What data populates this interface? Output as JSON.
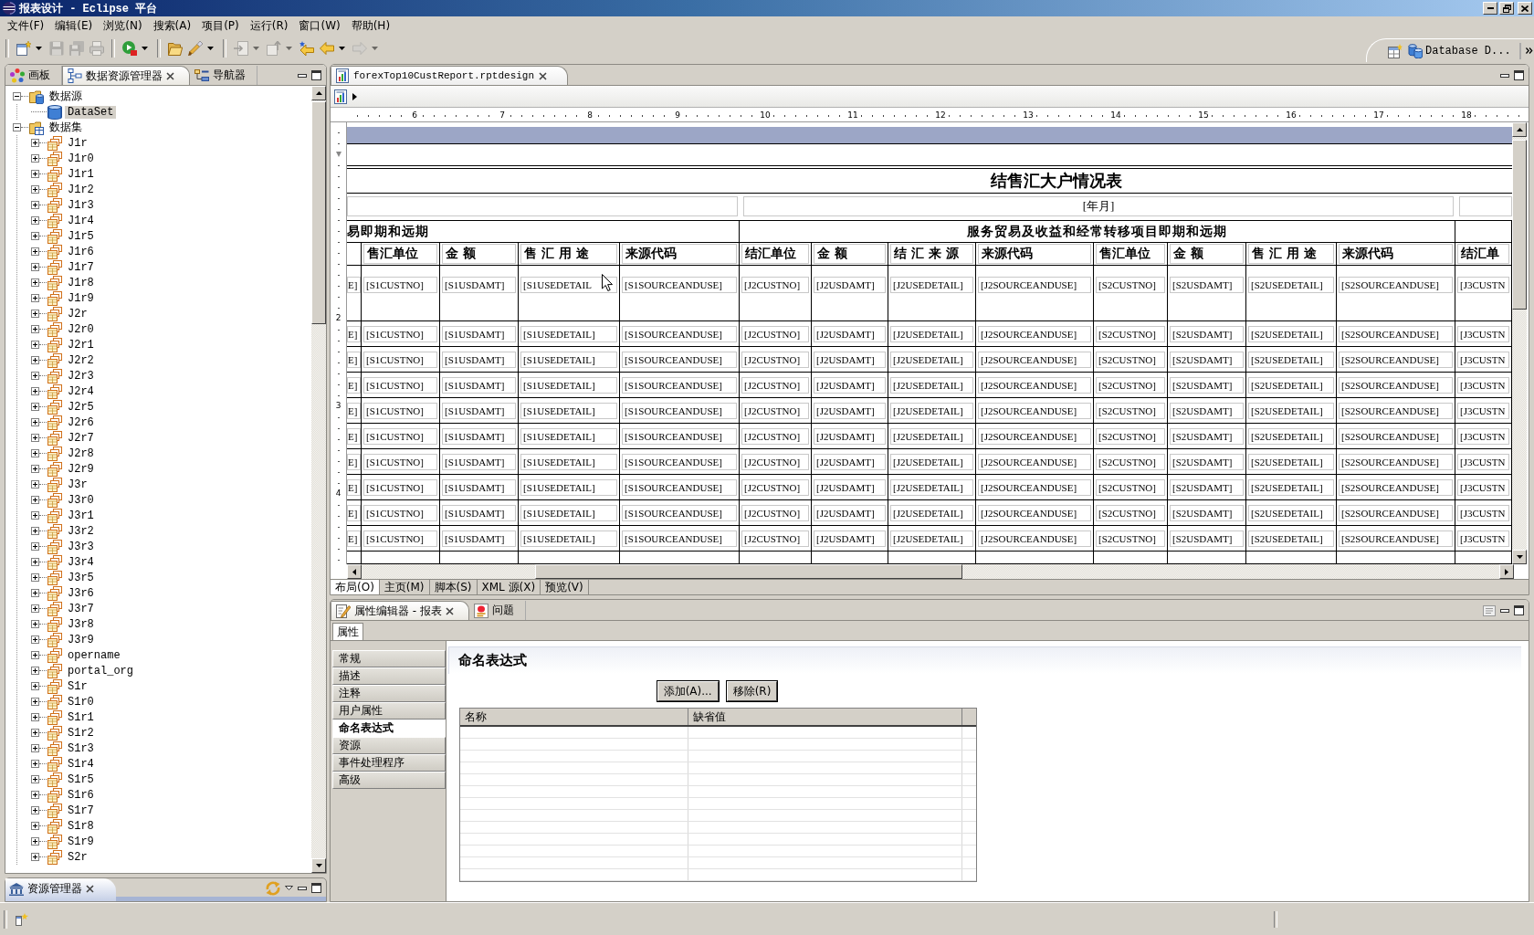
{
  "window": {
    "title": "报表设计 - Eclipse 平台"
  },
  "menu": [
    "文件(F)",
    "编辑(E)",
    "浏览(N)",
    "搜索(A)",
    "项目(P)",
    "运行(R)",
    "窗口(W)",
    "帮助(H)"
  ],
  "toolbar": [
    [
      {
        "kind": "new",
        "disabled": false,
        "dropdown": true
      },
      {
        "kind": "save",
        "disabled": true,
        "dropdown": false
      },
      {
        "kind": "saveall",
        "disabled": true,
        "dropdown": false
      },
      {
        "kind": "print",
        "disabled": true,
        "dropdown": false
      }
    ],
    [
      {
        "kind": "run",
        "disabled": false,
        "dropdown": true
      }
    ],
    [
      {
        "kind": "open",
        "disabled": false,
        "dropdown": false
      },
      {
        "kind": "brush",
        "disabled": false,
        "dropdown": true
      }
    ],
    [
      {
        "kind": "import",
        "disabled": true,
        "dropdown": true
      },
      {
        "kind": "export",
        "disabled": true,
        "dropdown": true
      },
      {
        "kind": "lastedit",
        "disabled": false,
        "dropdown": false
      },
      {
        "kind": "back",
        "disabled": false,
        "dropdown": true
      },
      {
        "kind": "forward",
        "disabled": true,
        "dropdown": true
      }
    ]
  ],
  "perspective_bar": {
    "label": "Database D..."
  },
  "left_panel": {
    "tabs": [
      {
        "label": "画板",
        "kind": "palette",
        "selected": false,
        "closable": false
      },
      {
        "label": "数据资源管理器",
        "kind": "data",
        "selected": true,
        "closable": true
      },
      {
        "label": "导航器",
        "kind": "navigator",
        "selected": false,
        "closable": false
      }
    ],
    "tree": [
      {
        "label": "数据源",
        "kind": "sources",
        "expanded": true,
        "selected": false,
        "children": [
          {
            "label": "DataSet",
            "selected": true
          }
        ]
      },
      {
        "label": "数据集",
        "kind": "sets",
        "expanded": true,
        "selected": false,
        "children": [
          {
            "label": "J1r",
            "expanded": false,
            "selected": false
          },
          {
            "label": "J1r0",
            "expanded": false,
            "selected": false
          },
          {
            "label": "J1r1",
            "expanded": false,
            "selected": false
          },
          {
            "label": "J1r2",
            "expanded": false,
            "selected": false
          },
          {
            "label": "J1r3",
            "expanded": false,
            "selected": false
          },
          {
            "label": "J1r4",
            "expanded": false,
            "selected": false
          },
          {
            "label": "J1r5",
            "expanded": false,
            "selected": false
          },
          {
            "label": "J1r6",
            "expanded": false,
            "selected": false
          },
          {
            "label": "J1r7",
            "expanded": false,
            "selected": false
          },
          {
            "label": "J1r8",
            "expanded": false,
            "selected": false
          },
          {
            "label": "J1r9",
            "expanded": false,
            "selected": false
          },
          {
            "label": "J2r",
            "expanded": false,
            "selected": false
          },
          {
            "label": "J2r0",
            "expanded": false,
            "selected": false
          },
          {
            "label": "J2r1",
            "expanded": false,
            "selected": false
          },
          {
            "label": "J2r2",
            "expanded": false,
            "selected": false
          },
          {
            "label": "J2r3",
            "expanded": false,
            "selected": false
          },
          {
            "label": "J2r4",
            "expanded": false,
            "selected": false
          },
          {
            "label": "J2r5",
            "expanded": false,
            "selected": false
          },
          {
            "label": "J2r6",
            "expanded": false,
            "selected": false
          },
          {
            "label": "J2r7",
            "expanded": false,
            "selected": false
          },
          {
            "label": "J2r8",
            "expanded": false,
            "selected": false
          },
          {
            "label": "J2r9",
            "expanded": false,
            "selected": false
          },
          {
            "label": "J3r",
            "expanded": false,
            "selected": false
          },
          {
            "label": "J3r0",
            "expanded": false,
            "selected": false
          },
          {
            "label": "J3r1",
            "expanded": false,
            "selected": false
          },
          {
            "label": "J3r2",
            "expanded": false,
            "selected": false
          },
          {
            "label": "J3r3",
            "expanded": false,
            "selected": false
          },
          {
            "label": "J3r4",
            "expanded": false,
            "selected": false
          },
          {
            "label": "J3r5",
            "expanded": false,
            "selected": false
          },
          {
            "label": "J3r6",
            "expanded": false,
            "selected": false
          },
          {
            "label": "J3r7",
            "expanded": false,
            "selected": false
          },
          {
            "label": "J3r8",
            "expanded": false,
            "selected": false
          },
          {
            "label": "J3r9",
            "expanded": false,
            "selected": false
          },
          {
            "label": "opername",
            "expanded": false,
            "selected": false
          },
          {
            "label": "portal_org",
            "expanded": false,
            "selected": false
          },
          {
            "label": "S1r",
            "expanded": false,
            "selected": false
          },
          {
            "label": "S1r0",
            "expanded": false,
            "selected": false
          },
          {
            "label": "S1r1",
            "expanded": false,
            "selected": false
          },
          {
            "label": "S1r2",
            "expanded": false,
            "selected": false
          },
          {
            "label": "S1r3",
            "expanded": false,
            "selected": false
          },
          {
            "label": "S1r4",
            "expanded": false,
            "selected": false
          },
          {
            "label": "S1r5",
            "expanded": false,
            "selected": false
          },
          {
            "label": "S1r6",
            "expanded": false,
            "selected": false
          },
          {
            "label": "S1r7",
            "expanded": false,
            "selected": false
          },
          {
            "label": "S1r8",
            "expanded": false,
            "selected": false
          },
          {
            "label": "S1r9",
            "expanded": false,
            "selected": false
          },
          {
            "label": "S2r",
            "expanded": false,
            "selected": false
          }
        ]
      }
    ]
  },
  "resource_panel": {
    "tab": {
      "label": "资源管理器"
    }
  },
  "editor": {
    "tab": {
      "label": "forexTop10CustReport.rptdesign"
    },
    "ruler": [
      "6",
      "7",
      "8",
      "9",
      "10",
      "11",
      "12",
      "13",
      "14",
      "15",
      "16",
      "17",
      "18"
    ],
    "vertical_ruler": [
      "2",
      "3",
      "4"
    ],
    "report": {
      "title": "结售汇大户情况表",
      "period": "[年月]",
      "groups": [
        "易即期和远期",
        "服务贸易及收益和经常转移项目即期和远期"
      ],
      "columns": [
        "",
        "售汇单位",
        "金 额",
        "售 汇 用 途",
        "来源代码",
        "结汇单位",
        "金 额",
        "结 汇 来 源",
        "来源代码",
        "售汇单位",
        "金 额",
        "售 汇 用 途",
        "来源代码",
        "结汇单"
      ],
      "rows": [
        [
          "E]",
          "[S1CUSTNO]",
          "[S1USDAMT]",
          "[S1USEDETAIL",
          "[S1SOURCEANDUSE]",
          "[J2CUSTNO]",
          "[J2USDAMT]",
          "[J2USEDETAIL]",
          "[J2SOURCEANDUSE]",
          "[S2CUSTNO]",
          "[S2USDAMT]",
          "[S2USEDETAIL]",
          "[S2SOURCEANDUSE]",
          "[J3CUSTN"
        ],
        [
          "E]",
          "[S1CUSTNO]",
          "[S1USDAMT]",
          "[S1USEDETAIL]",
          "[S1SOURCEANDUSE]",
          "[J2CUSTNO]",
          "[J2USDAMT]",
          "[J2USEDETAIL]",
          "[J2SOURCEANDUSE]",
          "[S2CUSTNO]",
          "[S2USDAMT]",
          "[S2USEDETAIL]",
          "[S2SOURCEANDUSE]",
          "[J3CUSTN"
        ],
        [
          "E]",
          "[S1CUSTNO]",
          "[S1USDAMT]",
          "[S1USEDETAIL]",
          "[S1SOURCEANDUSE]",
          "[J2CUSTNO]",
          "[J2USDAMT]",
          "[J2USEDETAIL]",
          "[J2SOURCEANDUSE]",
          "[S2CUSTNO]",
          "[S2USDAMT]",
          "[S2USEDETAIL]",
          "[S2SOURCEANDUSE]",
          "[J3CUSTN"
        ],
        [
          "E]",
          "[S1CUSTNO]",
          "[S1USDAMT]",
          "[S1USEDETAIL]",
          "[S1SOURCEANDUSE]",
          "[J2CUSTNO]",
          "[J2USDAMT]",
          "[J2USEDETAIL]",
          "[J2SOURCEANDUSE]",
          "[S2CUSTNO]",
          "[S2USDAMT]",
          "[S2USEDETAIL]",
          "[S2SOURCEANDUSE]",
          "[J3CUSTN"
        ],
        [
          "E]",
          "[S1CUSTNO]",
          "[S1USDAMT]",
          "[S1USEDETAIL]",
          "[S1SOURCEANDUSE]",
          "[J2CUSTNO]",
          "[J2USDAMT]",
          "[J2USEDETAIL]",
          "[J2SOURCEANDUSE]",
          "[S2CUSTNO]",
          "[S2USDAMT]",
          "[S2USEDETAIL]",
          "[S2SOURCEANDUSE]",
          "[J3CUSTN"
        ],
        [
          "E]",
          "[S1CUSTNO]",
          "[S1USDAMT]",
          "[S1USEDETAIL]",
          "[S1SOURCEANDUSE]",
          "[J2CUSTNO]",
          "[J2USDAMT]",
          "[J2USEDETAIL]",
          "[J2SOURCEANDUSE]",
          "[S2CUSTNO]",
          "[S2USDAMT]",
          "[S2USEDETAIL]",
          "[S2SOURCEANDUSE]",
          "[J3CUSTN"
        ],
        [
          "E]",
          "[S1CUSTNO]",
          "[S1USDAMT]",
          "[S1USEDETAIL]",
          "[S1SOURCEANDUSE]",
          "[J2CUSTNO]",
          "[J2USDAMT]",
          "[J2USEDETAIL]",
          "[J2SOURCEANDUSE]",
          "[S2CUSTNO]",
          "[S2USDAMT]",
          "[S2USEDETAIL]",
          "[S2SOURCEANDUSE]",
          "[J3CUSTN"
        ],
        [
          "E]",
          "[S1CUSTNO]",
          "[S1USDAMT]",
          "[S1USEDETAIL]",
          "[S1SOURCEANDUSE]",
          "[J2CUSTNO]",
          "[J2USDAMT]",
          "[J2USEDETAIL]",
          "[J2SOURCEANDUSE]",
          "[S2CUSTNO]",
          "[S2USDAMT]",
          "[S2USEDETAIL]",
          "[S2SOURCEANDUSE]",
          "[J3CUSTN"
        ],
        [
          "E]",
          "[S1CUSTNO]",
          "[S1USDAMT]",
          "[S1USEDETAIL]",
          "[S1SOURCEANDUSE]",
          "[J2CUSTNO]",
          "[J2USDAMT]",
          "[J2USEDETAIL]",
          "[J2SOURCEANDUSE]",
          "[S2CUSTNO]",
          "[S2USDAMT]",
          "[S2USEDETAIL]",
          "[S2SOURCEANDUSE]",
          "[J3CUSTN"
        ],
        [
          "E]",
          "[S1CUSTNO]",
          "[S1USDAMT]",
          "[S1USEDETAIL]",
          "[S1SOURCEANDUSE]",
          "[J2CUSTNO]",
          "[J2USDAMT]",
          "[J2USEDETAIL]",
          "[J2SOURCEANDUSE]",
          "[S2CUSTNO]",
          "[S2USDAMT]",
          "[S2USEDETAIL]",
          "[S2SOURCEANDUSE]",
          "[J3CUSTN"
        ]
      ]
    },
    "tabs": [
      {
        "label": "布局(O)",
        "selected": true
      },
      {
        "label": "主页(M)",
        "selected": false
      },
      {
        "label": "脚本(S)",
        "selected": false
      },
      {
        "label": "XML 源(X)",
        "selected": false
      },
      {
        "label": "预览(V)",
        "selected": false
      }
    ]
  },
  "properties": {
    "tabs": [
      {
        "label": "属性编辑器 - 报表",
        "kind": "editor",
        "selected": true,
        "closable": true
      },
      {
        "label": "问题",
        "kind": "problems",
        "selected": false,
        "closable": false
      }
    ],
    "subtab": "属性",
    "categories": [
      {
        "label": "常规",
        "selected": false
      },
      {
        "label": "描述",
        "selected": false
      },
      {
        "label": "注释",
        "selected": false
      },
      {
        "label": "用户属性",
        "selected": false
      },
      {
        "label": "命名表达式",
        "selected": true
      },
      {
        "label": "资源",
        "selected": false
      },
      {
        "label": "事件处理程序",
        "selected": false
      },
      {
        "label": "高级",
        "selected": false
      }
    ],
    "section_title": "命名表达式",
    "buttons": [
      "添加(A)...",
      "移除(R)"
    ],
    "table": {
      "columns": [
        "名称",
        "缺省值"
      ]
    }
  }
}
